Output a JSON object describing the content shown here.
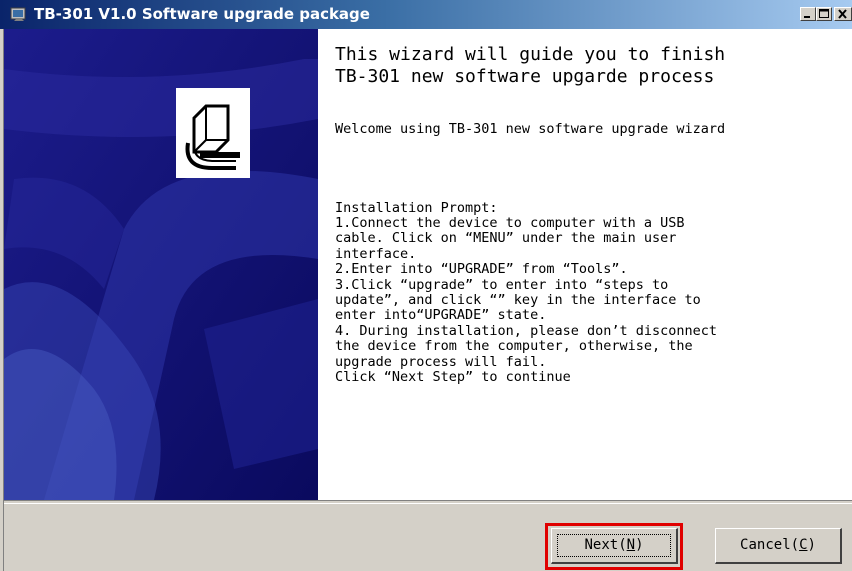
{
  "window": {
    "title": "TB-301  V1.0 Software upgrade package"
  },
  "content": {
    "heading": "This wizard will guide you to finish\nTB-301 new software upgarde process",
    "welcome": "Welcome using TB-301 new software upgrade wizard",
    "prompt_title": "Installation Prompt:",
    "prompt_lines": [
      "1.Connect the device to computer with a USB",
      "cable. Click on “MENU” under the main user",
      "interface.",
      "2.Enter into “UPGRADE” from “Tools”.",
      "3.Click “upgrade” to enter into “steps to",
      "update”, and click “” key in the interface to",
      "enter into“UPGRADE” state.",
      "4. During installation, please don’t disconnect",
      "the device from the computer, otherwise, the",
      "upgrade process will fail.",
      "Click “Next Step” to continue"
    ]
  },
  "buttons": {
    "next_label": "Next",
    "next_hotkey": "N",
    "cancel_label": "Cancel",
    "cancel_hotkey": "C"
  },
  "icons": {
    "app": "app-icon",
    "logo": "computer-upgrade-icon",
    "minimize": "minimize-icon",
    "maximize": "maximize-icon",
    "close": "close-icon"
  },
  "colors": {
    "title_bar_start": "#0a246a",
    "title_bar_end": "#a6caf0",
    "left_panel": "#10107a",
    "button_face": "#d4d0c8",
    "highlight": "#e00000"
  }
}
